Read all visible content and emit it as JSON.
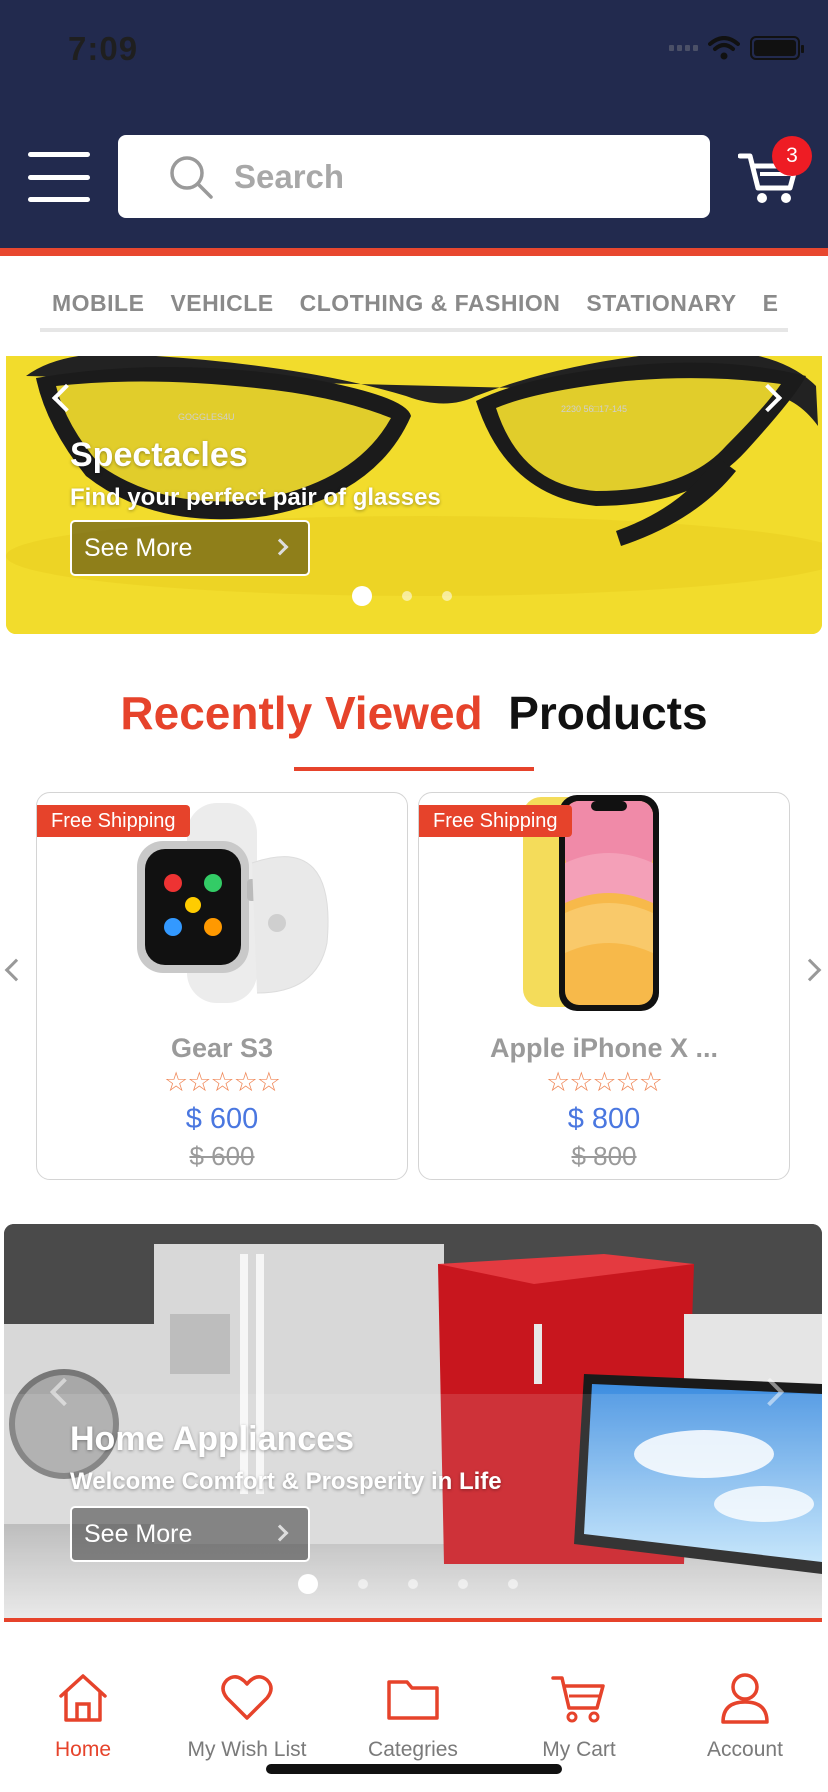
{
  "status_bar": {
    "time": "7:09"
  },
  "header": {
    "search_placeholder": "Search",
    "cart_count": "3",
    "colors": {
      "background": "#222a4e",
      "accent": "#e8472f",
      "badge": "#ee1c24"
    }
  },
  "categories": [
    "MOBILE",
    "VEHICLE",
    "CLOTHING & FASHION",
    "STATIONARY",
    "E"
  ],
  "banner_top": {
    "title": "Spectacles",
    "subtitle": "Find your perfect pair of glasses",
    "button_label": "See More",
    "frame_text_left": "GOGGLES4U",
    "frame_text_right": "2230 56□17-145",
    "slides_count": 3,
    "active_slide": 1
  },
  "recently_viewed": {
    "title_accent": "Recently Viewed",
    "title_rest": "Products",
    "products": [
      {
        "badge": "Free Shipping",
        "name": "Gear S3",
        "stars": "☆☆☆☆☆",
        "price": "$ 600",
        "old_price": "$ 600",
        "image": "smartwatch-image"
      },
      {
        "badge": "Free Shipping",
        "name": "Apple iPhone X ...",
        "stars": "☆☆☆☆☆",
        "price": "$ 800",
        "old_price": "$ 800",
        "image": "iphone-image"
      }
    ]
  },
  "banner_bottom": {
    "title": "Home Appliances",
    "subtitle": "Welcome Comfort & Prosperity in Life",
    "button_label": "See More",
    "slides_count": 5,
    "active_slide": 1
  },
  "bottom_nav": [
    {
      "label": "Home",
      "icon": "home-icon",
      "active": true
    },
    {
      "label": "My Wish List",
      "icon": "heart-icon",
      "active": false
    },
    {
      "label": "Categries",
      "icon": "folder-icon",
      "active": false
    },
    {
      "label": "My Cart",
      "icon": "cart-icon",
      "active": false
    },
    {
      "label": "Account",
      "icon": "user-icon",
      "active": false
    }
  ]
}
